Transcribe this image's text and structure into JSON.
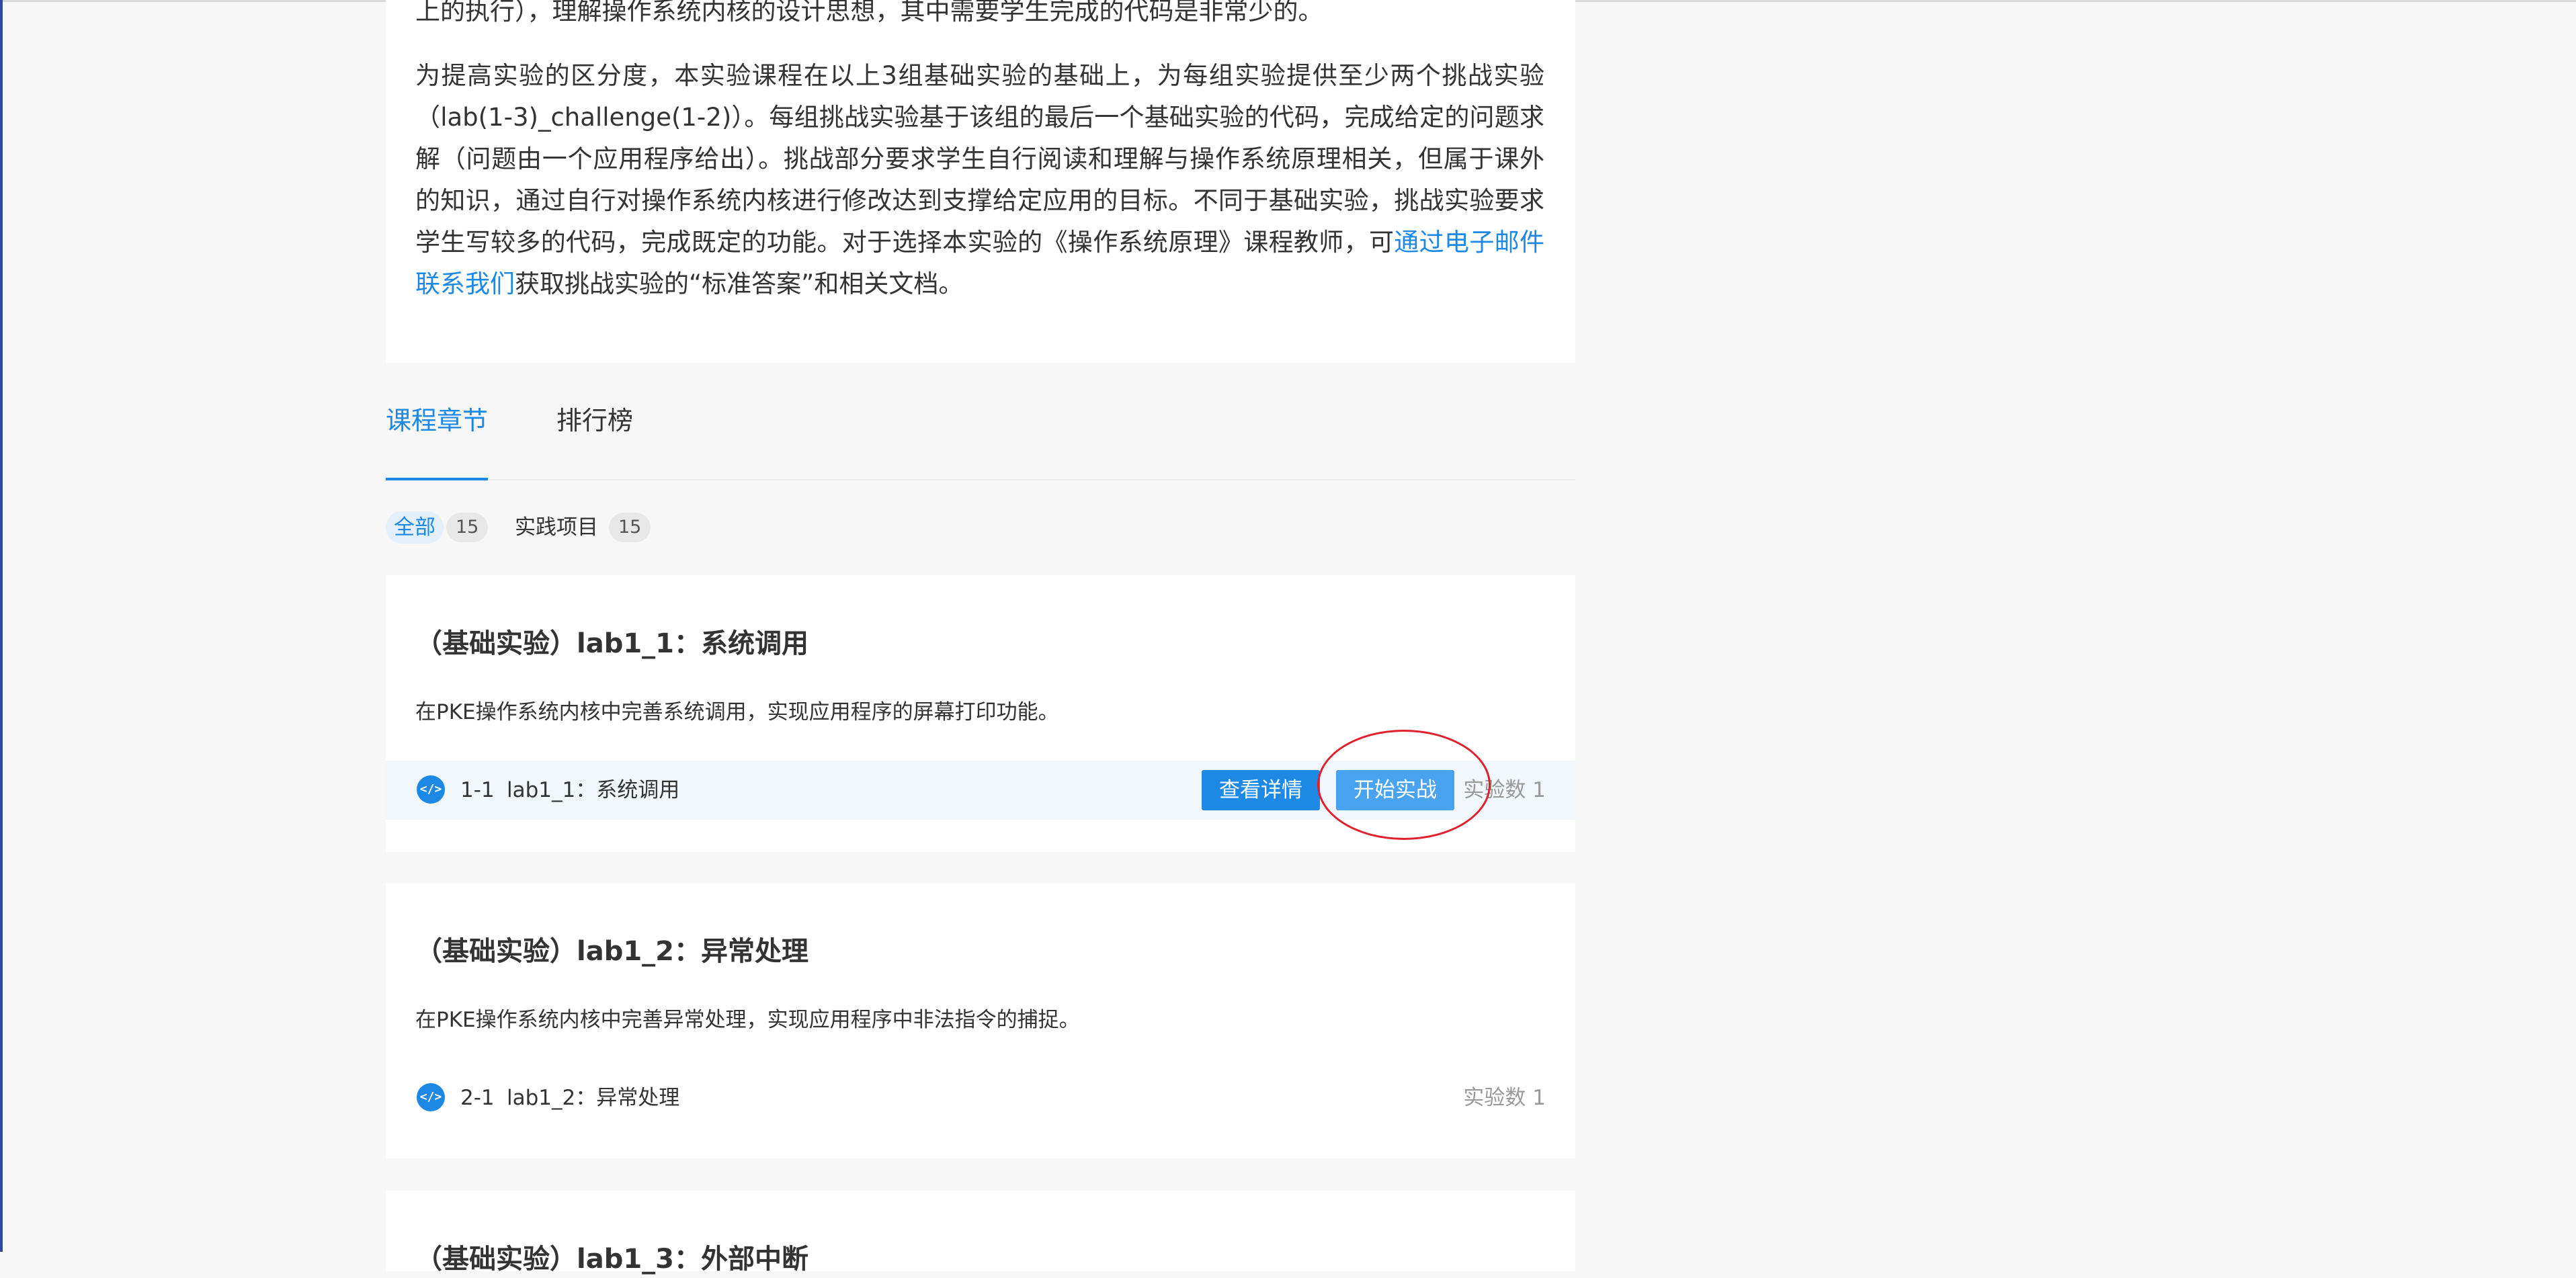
{
  "intro": {
    "line_top": "上的执行），理解操作系统内核的设计思想，其中需要学生完成的代码是非常少的。",
    "paragraph": "为提高实验的区分度，本实验课程在以上3组基础实验的基础上，为每组实验提供至少两个挑战实验（lab(1-3)_challenge(1-2)）。每组挑战实验基于该组的最后一个基础实验的代码，完成给定的问题求解（问题由一个应用程序给出）。挑战部分要求学生自行阅读和理解与操作系统原理相关，但属于课外的知识，通过自行对操作系统内核进行修改达到支撑给定应用的目标。不同于基础实验，挑战实验要求学生写较多的代码，完成既定的功能。对于选择本实验的《操作系统原理》课程教师，可",
    "link_text": "通过电子邮件联系我们",
    "paragraph_end": "获取挑战实验的“标准答案”和相关文档。"
  },
  "tabs": [
    {
      "label": "课程章节",
      "active": true
    },
    {
      "label": "排行榜",
      "active": false
    }
  ],
  "filters": [
    {
      "label": "全部",
      "count": "15",
      "active": true
    },
    {
      "label": "实践项目",
      "count": "15",
      "active": false
    }
  ],
  "chapters": [
    {
      "title": "（基础实验）lab1_1：系统调用",
      "description": "在PKE操作系统内核中完善系统调用，实现应用程序的屏幕打印功能。",
      "lab": {
        "number": "1-1",
        "name": "lab1_1：系统调用",
        "count_label": "实验数 1"
      },
      "buttons": {
        "detail": "查看详情",
        "start": "开始实战"
      }
    },
    {
      "title": "（基础实验）lab1_2：异常处理",
      "description": "在PKE操作系统内核中完善异常处理，实现应用程序中非法指令的捕捉。",
      "lab": {
        "number": "2-1",
        "name": "lab1_2：异常处理",
        "count_label": "实验数 1"
      }
    },
    {
      "title": "（基础实验）lab1_3：外部中断"
    }
  ],
  "icons": {
    "lab_icon": "code-icon",
    "lab_icon_glyph": "</>"
  },
  "colors": {
    "accent": "#1e88e5",
    "start_button": "#4aa3ee",
    "highlight_ring": "#e0202a",
    "page_background": "#f7f7f7"
  }
}
